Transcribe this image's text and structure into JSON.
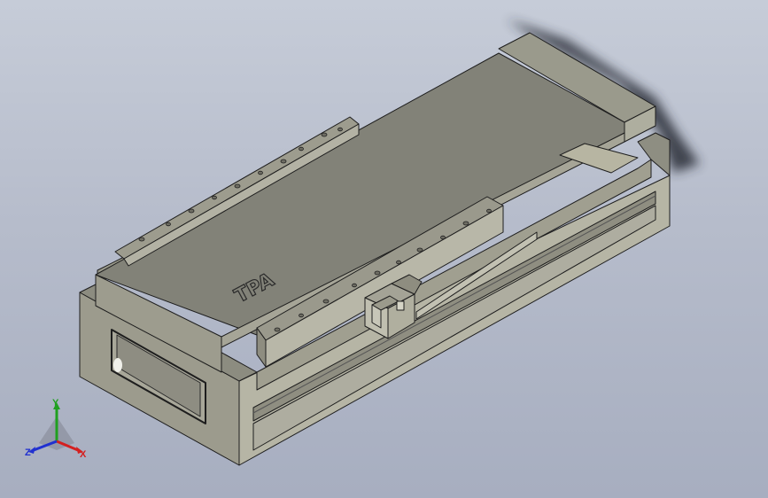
{
  "viewport": {
    "background_top": "#c6ccd8",
    "background_bottom": "#a7aec0"
  },
  "model": {
    "face_top": "#8a8a7e",
    "face_side": "#b9b8a8",
    "face_front": "#9e9d8f",
    "edge": "#1e1e1e",
    "logo": "TPA"
  },
  "triad": {
    "x_label": "X",
    "y_label": "Y",
    "z_label": "Z",
    "x_color": "#d42020",
    "y_color": "#20a020",
    "z_color": "#2030d0"
  }
}
